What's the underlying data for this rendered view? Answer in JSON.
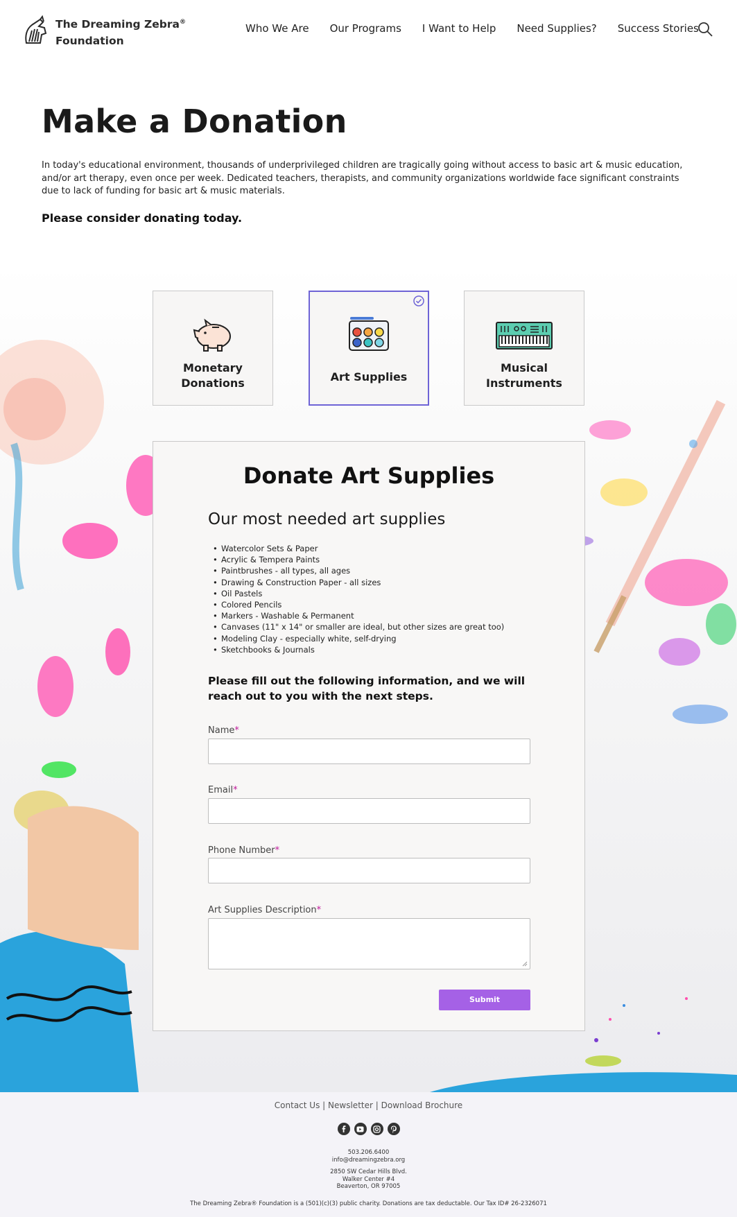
{
  "header": {
    "logo_line1": "The Dreaming Zebra",
    "logo_reg": "®",
    "logo_line2": "Foundation",
    "nav": [
      "Who We Are",
      "Our Programs",
      "I Want to Help",
      "Need Supplies?",
      "Success Stories"
    ]
  },
  "intro": {
    "title": "Make a Donation",
    "paragraph": "In today's educational environment, thousands of underprivileged children are tragically going without access to basic art & music education, and/or art therapy, even once per week. Dedicated teachers, therapists, and community organizations worldwide face significant constraints due to lack of funding for basic art & music materials.",
    "consider": "Please consider donating today."
  },
  "cards": [
    {
      "line1": "Monetary",
      "line2": "Donations",
      "icon": "piggy-bank-icon",
      "selected": false
    },
    {
      "line1": "Art Supplies",
      "line2": "",
      "icon": "paint-palette-icon",
      "selected": true
    },
    {
      "line1": "Musical",
      "line2": "Instruments",
      "icon": "keyboard-synth-icon",
      "selected": false
    }
  ],
  "panel": {
    "title": "Donate Art Supplies",
    "subtitle": "Our most needed art supplies",
    "supplies": [
      "Watercolor Sets & Paper",
      "Acrylic & Tempera Paints",
      "Paintbrushes - all types, all ages",
      "Drawing & Construction Paper - all sizes",
      "Oil Pastels",
      "Colored Pencils",
      "Markers - Washable & Permanent",
      "Canvases (11\" x 14\" or smaller are ideal, but other sizes are great too)",
      "Modeling Clay - especially white, self-drying",
      "Sketchbooks & Journals"
    ],
    "fill_text": "Please fill out the following information, and we will reach out to you with the next steps.",
    "fields": {
      "name_label": "Name",
      "email_label": "Email",
      "phone_label": "Phone Number",
      "description_label": "Art Supplies Description",
      "required_mark": "*"
    },
    "submit_label": "Submit"
  },
  "footer": {
    "link_contact": "Contact Us",
    "link_newsletter": "Newsletter",
    "link_brochure": "Download Brochure",
    "separator": "|",
    "socials": [
      "facebook-icon",
      "youtube-icon",
      "instagram-icon",
      "pinterest-icon"
    ],
    "phone": "503.206.6400",
    "email": "info@dreamingzebra.org",
    "address1": "2850 SW Cedar Hills Blvd.",
    "address2": "Walker Center #4",
    "address3": "Beaverton, OR 97005",
    "legal": "The Dreaming Zebra® Foundation is a (501)(c)(3) public charity. Donations are tax deductable. Our Tax ID# 26-2326071"
  },
  "colors": {
    "accent": "#6e63d6",
    "submit": "#a561e6",
    "required": "#c0189a",
    "footer_bg": "#f4f3f8"
  }
}
